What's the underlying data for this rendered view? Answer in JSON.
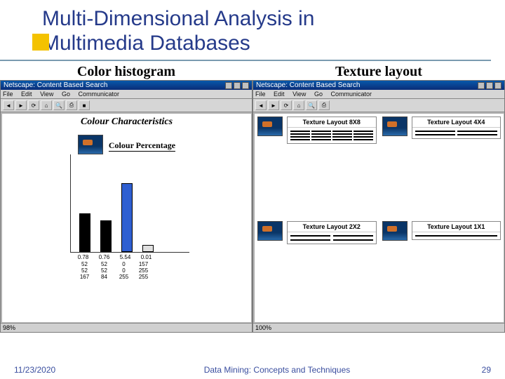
{
  "slide": {
    "title_line1": "Multi-Dimensional Analysis in",
    "title_line2": "Multimedia Databases"
  },
  "sections": {
    "left_label": "Color histogram",
    "right_label": "Texture layout"
  },
  "left_app": {
    "titlebar": "Netscape: Content Based Search",
    "menus": [
      "File",
      "Edit",
      "View",
      "Go",
      "Communicator"
    ],
    "heading": "Colour Characteristics",
    "sub_heading": "Colour Percentage",
    "status": "98%"
  },
  "right_app": {
    "titlebar": "Netscape: Content Based Search",
    "menus": [
      "File",
      "Edit",
      "View",
      "Go",
      "Communicator"
    ],
    "panels": {
      "tl": "Texture Layout 8X8",
      "tr": "Texture Layout 4X4",
      "bl": "Texture Layout 2X2",
      "br": "Texture Layout 1X1"
    },
    "status": "100%"
  },
  "chart_data": {
    "type": "bar",
    "title": "Colour Percentage",
    "categories": [
      "0.78",
      "0.76",
      "5.54",
      "0.01"
    ],
    "values": [
      0.78,
      0.76,
      5.54,
      0.01
    ],
    "colors": [
      "#000000",
      "#000000",
      "#2f5fd1",
      "#e0e0e0"
    ],
    "ylim": [
      0,
      6
    ],
    "table_rows": [
      [
        "52",
        "52",
        "0",
        "157"
      ],
      [
        "52",
        "52",
        "0",
        "255"
      ],
      [
        "167",
        "84",
        "255",
        "255"
      ]
    ]
  },
  "footer": {
    "date": "11/23/2020",
    "caption": "Data Mining: Concepts and Techniques",
    "page": "29"
  }
}
